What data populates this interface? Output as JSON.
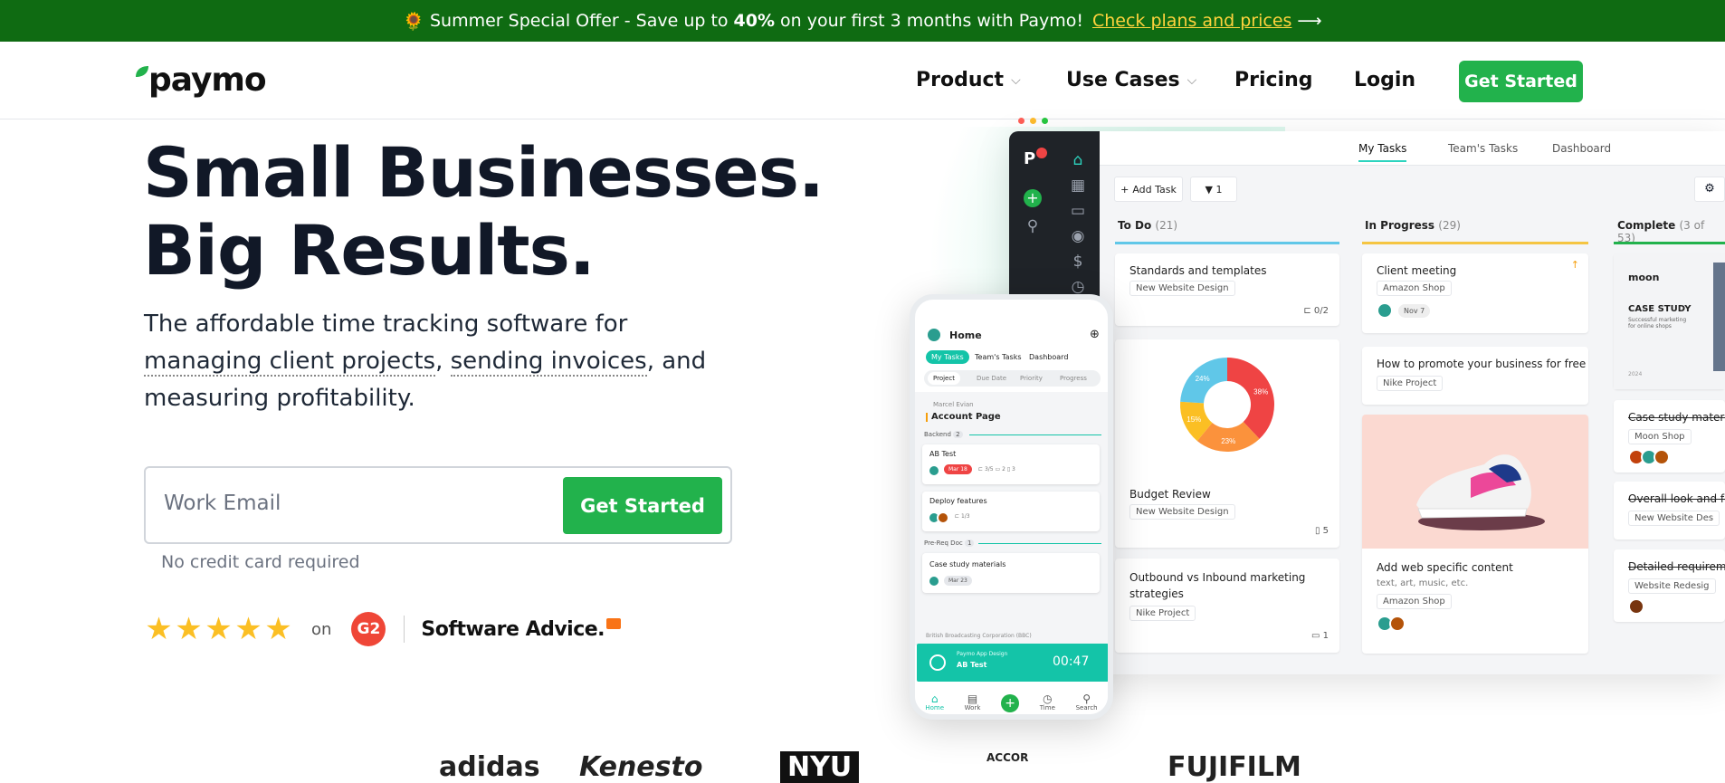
{
  "banner": {
    "emoji": "🌻",
    "text_before": "Summer Special Offer - Save up to",
    "bold": "40%",
    "text_after": "on your first 3 months with Paymo!",
    "link": "Check plans and prices",
    "arrow": "⟶"
  },
  "nav": {
    "logo": "paymo",
    "items": [
      {
        "label": "Product",
        "dropdown": true
      },
      {
        "label": "Use Cases",
        "dropdown": true
      },
      {
        "label": "Pricing",
        "dropdown": false
      },
      {
        "label": "Login",
        "dropdown": false
      }
    ],
    "cta": "Get Started"
  },
  "hero": {
    "title_line1": "Small Businesses.",
    "title_line2": "Big Results.",
    "sub_1": "The affordable time tracking software for ",
    "sub_link1": "managing client projects",
    "sub_2": ", ",
    "sub_link2": "sending invoices",
    "sub_3": ", and measuring profitability.",
    "email_placeholder": "Work Email",
    "email_button": "Get Started",
    "note": "No credit card required",
    "rating_on": "on",
    "g2": "G2",
    "software_advice": "Software Advice."
  },
  "app": {
    "tabs": [
      "My Tasks",
      "Team's Tasks",
      "Dashboard"
    ],
    "add_task": "Add Task",
    "filter_count": "1",
    "columns": [
      {
        "name": "To Do",
        "count": "(21)",
        "color": "#60c7e8"
      },
      {
        "name": "In Progress",
        "count": "(29)",
        "color": "#f5c542"
      },
      {
        "name": "Complete",
        "count": "(3 of 53)",
        "color": "#22b24c"
      }
    ],
    "todo": {
      "c1_title": "Standards and templates",
      "c1_tag": "New Website Design",
      "c1_meta": "0/2",
      "pie_labels": [
        "24%",
        "38%",
        "15%",
        "23%"
      ],
      "c2_title": "Budget Review",
      "c2_tag": "New Website Design",
      "c2_meta": "5",
      "c3_title": "Outbound vs Inbound marketing strategies",
      "c3_tag": "Nike Project",
      "c3_meta": "1"
    },
    "progress": {
      "c1_title": "Client meeting",
      "c1_tag": "Amazon Shop",
      "c1_date": "Nov 7",
      "c2_title": "How to promote your business for free",
      "c2_tag": "Nike Project",
      "c3_title": "Add web specific content",
      "c3_sub": "text, art, music, etc.",
      "c3_tag": "Amazon Shop"
    },
    "complete": {
      "moon": "moon",
      "cs_title": "CASE STUDY",
      "cs_sub": "Successful marketing for online shops",
      "cs_year": "2024",
      "c1_title": "Case study materi",
      "c1_tag": "Moon Shop",
      "c2_title": "Overall look and fe",
      "c2_tag": "New Website Des",
      "c3_title": "Detailed requireme",
      "c3_tag": "Website Redesig"
    }
  },
  "phone": {
    "title": "Home",
    "tabs": [
      "My Tasks",
      "Team's Tasks",
      "Dashboard"
    ],
    "subtabs": [
      "Project",
      "Due Date",
      "Priority",
      "Progress"
    ],
    "owner": "Marcel Evian",
    "project": "Account Page",
    "group1": "Backend",
    "group1_count": "2",
    "t1": "AB Test",
    "t1_date": "Mar 18",
    "t1_meta": "3/5",
    "t1_c": "2",
    "t1_a": "3",
    "t2": "Deploy features",
    "t2_meta": "1/3",
    "group2": "Pre-Req Doc",
    "group2_count": "1",
    "t3": "Case study materials",
    "t3_date": "Mar 23",
    "client": "British Broadcasting Corporation (BBC)",
    "timer_project": "Paymo App Design",
    "timer_task": "AB Test",
    "timer_time": "00:47",
    "bottom": [
      "Home",
      "Work",
      "",
      "Time",
      "Search"
    ]
  },
  "logos": [
    "adidas",
    "Kenesto",
    "NYU",
    "ACCOR",
    "FUJIFILM"
  ]
}
